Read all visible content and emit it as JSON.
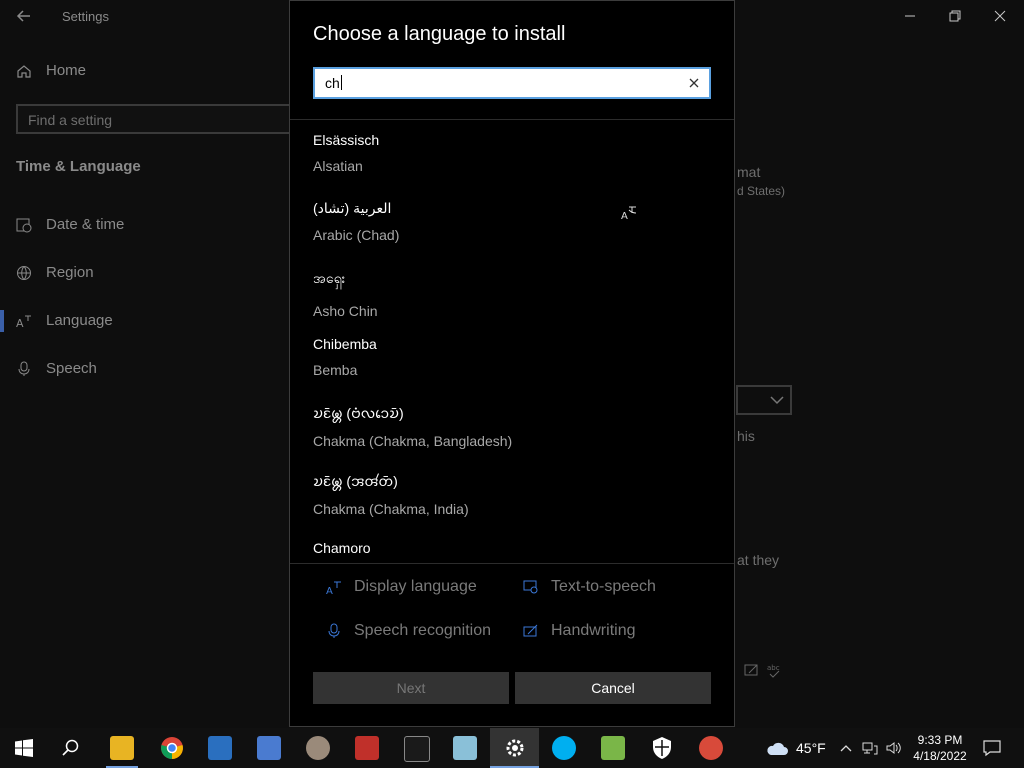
{
  "settings": {
    "title": "Settings",
    "home_label": "Home",
    "search_placeholder": "Find a setting",
    "section_title": "Time & Language",
    "nav": [
      {
        "label": "Date & time",
        "icon": "calendar-clock-icon"
      },
      {
        "label": "Region",
        "icon": "globe-icon"
      },
      {
        "label": "Language",
        "icon": "language-icon"
      },
      {
        "label": "Speech",
        "icon": "microphone-icon"
      }
    ],
    "right_fragments": {
      "format": "mat",
      "region": "d States)",
      "this": "his",
      "they": "at they"
    }
  },
  "dialog": {
    "title": "Choose a language to install",
    "search_value": "ch",
    "languages": [
      {
        "native": "Elsässisch",
        "english": "Alsatian"
      },
      {
        "native": "العربية (تشاد)",
        "english": "Arabic (Chad)"
      },
      {
        "native": "အရှေး",
        "english": "Asho Chin"
      },
      {
        "native": "Chibemba",
        "english": "Bemba"
      },
      {
        "native": "𑄌𑄋𑄴𑄟𑄳𑄦 (𑄝𑄁𑄣𑄘𑄬𑄌𑄴)",
        "english": "Chakma (Chakma, Bangladesh)"
      },
      {
        "native": "𑄌𑄋𑄴𑄟𑄳𑄦 (𑄞𑄢𑄧𑄖𑄴)",
        "english": "Chakma (Chakma, India)"
      },
      {
        "native": "Chamoro",
        "english": ""
      }
    ],
    "features": [
      {
        "label": "Display language",
        "icon": "display-language-icon"
      },
      {
        "label": "Text-to-speech",
        "icon": "text-to-speech-icon"
      },
      {
        "label": "Speech recognition",
        "icon": "microphone-icon"
      },
      {
        "label": "Handwriting",
        "icon": "handwriting-icon"
      }
    ],
    "next_label": "Next",
    "cancel_label": "Cancel"
  },
  "taskbar": {
    "weather_temp": "45°F",
    "time": "9:33 PM",
    "date": "4/18/2022"
  }
}
